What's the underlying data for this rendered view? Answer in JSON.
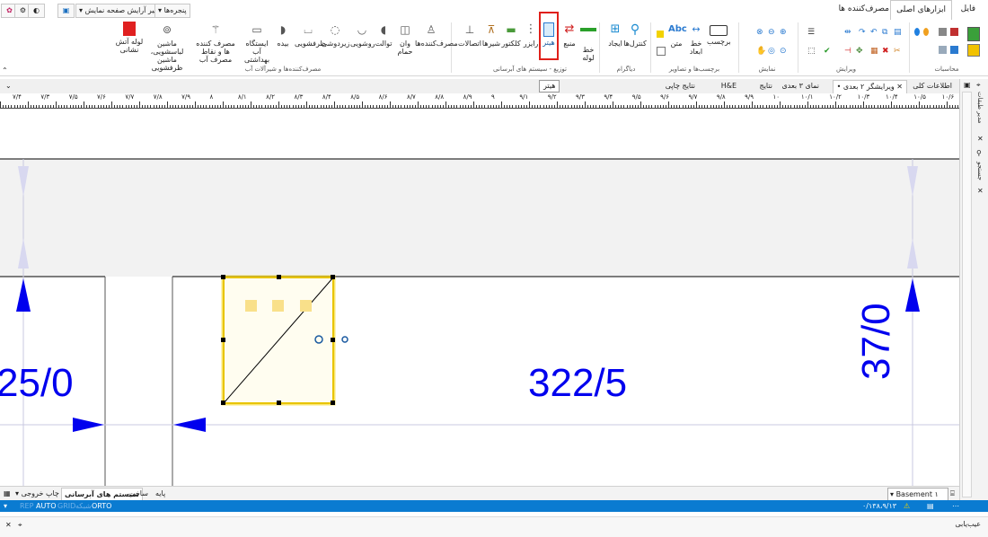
{
  "menu_tabs": {
    "file": "فایل",
    "main_tools": "ابزارهای اصلی",
    "consumers": "مصرف‌کننده ها"
  },
  "quick_access": {
    "change_display": "تغییر آرایش صفحه نمایش",
    "windows": "پنجره‌ها"
  },
  "ribbon": {
    "calc": {
      "group": "محاسبات"
    },
    "edit": {
      "group": "ویرایش"
    },
    "display": {
      "group": "نمایش"
    },
    "labels": {
      "group": "برچسب‌ها و تصاویر",
      "label": "برچسب",
      "dim_line": "خط ابعاد",
      "text": "متن"
    },
    "diagram": {
      "group": "دیاگرام",
      "controls": "کنترل‌ها",
      "create": "ایجاد"
    },
    "distribution": {
      "group": "توزیع - سیستم های آبرسانی",
      "pipe_line": "خط لوله",
      "source": "منبع",
      "heater": "هیتر",
      "riser": "رایزر",
      "collector": "کلکتور",
      "valves": "شیرها",
      "connections": "اتصالات"
    },
    "fixtures": {
      "group": "مصرف‌کننده‌ها و شیرآلات آب",
      "consumers": "مصرف‌کننده‌ها",
      "bathtub": "وان حمام",
      "toilet": "توالت",
      "washbasin": "روشویی",
      "bidet_under": "زیردوشی",
      "dishwasher": "ظرفشویی",
      "bidet": "بیده",
      "water_station": "ایستگاه آب بهداشتی",
      "consumer_points": "مصرف کننده ها و نقاط مصرف آب",
      "washing_machine": "ماشین لباسشویی، ماشین ظرفشویی",
      "fire_pipe": "لوله آتش نشانی"
    }
  },
  "doc_tabs": {
    "general_info": "اطلاعات کلی",
    "editor": "• ویرایشگر ۲ بعدی",
    "view3d": "نمای ۳ بعدی",
    "results": "نتایج",
    "he": "H&E",
    "print_results": "نتایج چاپی"
  },
  "tooltip": "هیتر",
  "ruler_labels": [
    "۷/۴",
    "۷/۳",
    "۷/۵",
    "۷/۶",
    "۷/۷",
    "۷/۸",
    "۷/۹",
    "۸",
    "۸/۱",
    "۸/۲",
    "۸/۳",
    "۸/۴",
    "۸/۵",
    "۸/۶",
    "۸/۷",
    "۸/۸",
    "۸/۹",
    "۹",
    "۹/۱",
    "۹/۲",
    "۹/۳",
    "۹/۴",
    "۹/۵",
    "۹/۶",
    "۹/۷",
    "۹/۸",
    "۹/۹",
    "۱۰",
    "۱۰/۱",
    "۱۰/۲",
    "۱۰/۳",
    "۱۰/۴",
    "۱۰/۵",
    "۱۰/۶"
  ],
  "canvas": {
    "dim_left": "25/0",
    "dim_center": "322/5",
    "dim_right": "37/0"
  },
  "right_panel": {
    "floor_manager": "مدیر طبقات",
    "explorer": "جستجو"
  },
  "bottom_tabs": {
    "print": "چاپ خروجی",
    "water_systems": "سیستم های آبرسانی",
    "construction": "ساخت",
    "base": "پایه"
  },
  "floor": {
    "value": "Basement ۱"
  },
  "status": {
    "rep": "REP",
    "auto": "AUTO",
    "grid": "GRID",
    "snap": "شبکه",
    "orto": "ORTO",
    "coords": "۰/۱۳۸،۹/۱۳"
  },
  "error_bar": {
    "label": "عیب‌یابی"
  },
  "colors": {
    "accent": "#0a7bd1",
    "dimension": "#0000ee",
    "selection": "#f5d400",
    "highlight": "#e0201a"
  }
}
